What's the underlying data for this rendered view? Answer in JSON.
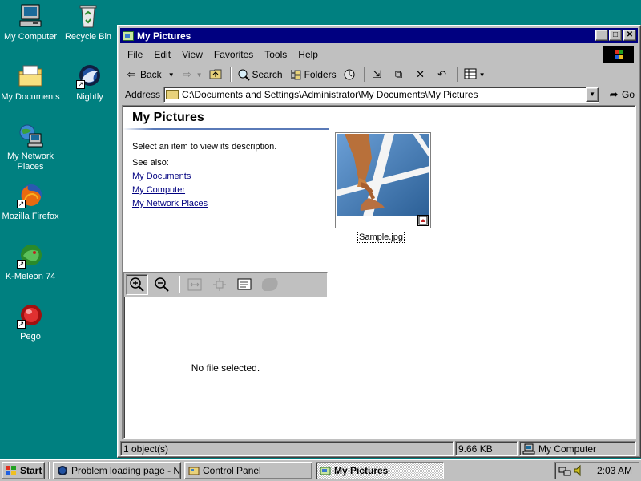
{
  "desktop": {
    "icons": [
      {
        "label": "My Computer",
        "icon": "my-computer-icon"
      },
      {
        "label": "Recycle Bin",
        "icon": "recycle-bin-icon"
      },
      {
        "label": "My Documents",
        "icon": "my-documents-icon"
      },
      {
        "label": "Nightly",
        "icon": "nightly-icon"
      },
      {
        "label": "My Network Places",
        "icon": "network-places-icon"
      },
      {
        "label": "Mozilla Firefox",
        "icon": "firefox-icon"
      },
      {
        "label": "K-Meleon 74",
        "icon": "k-meleon-icon"
      },
      {
        "label": "Pego",
        "icon": "pego-icon"
      }
    ]
  },
  "window": {
    "title": "My Pictures",
    "menu": [
      "File",
      "Edit",
      "View",
      "Favorites",
      "Tools",
      "Help"
    ],
    "menu_underline": [
      "F",
      "E",
      "V",
      "a",
      "T",
      "H"
    ],
    "toolbar": {
      "back": "Back",
      "search": "Search",
      "folders": "Folders"
    },
    "address": {
      "label": "Address",
      "value": "C:\\Documents and Settings\\Administrator\\My Documents\\My Pictures",
      "go": "Go"
    },
    "left_pane": {
      "title": "My Pictures",
      "description": "Select an item to view its description.",
      "see_also": "See also:",
      "links": [
        "My Documents",
        "My Computer",
        "My Network Places"
      ]
    },
    "preview": {
      "empty_text": "No file selected."
    },
    "files": [
      {
        "name": "Sample.jpg"
      }
    ],
    "status": {
      "objects": "1 object(s)",
      "size": "9.66 KB",
      "zone": "My Computer"
    }
  },
  "taskbar": {
    "start": "Start",
    "tasks": [
      {
        "label": "Problem loading page - Nig...",
        "active": false
      },
      {
        "label": "Control Panel",
        "active": false
      },
      {
        "label": "My Pictures",
        "active": true
      }
    ],
    "clock": "2:03 AM"
  },
  "colors": {
    "desktop": "#008080",
    "titlebar": "#000080",
    "link": "#000080"
  }
}
